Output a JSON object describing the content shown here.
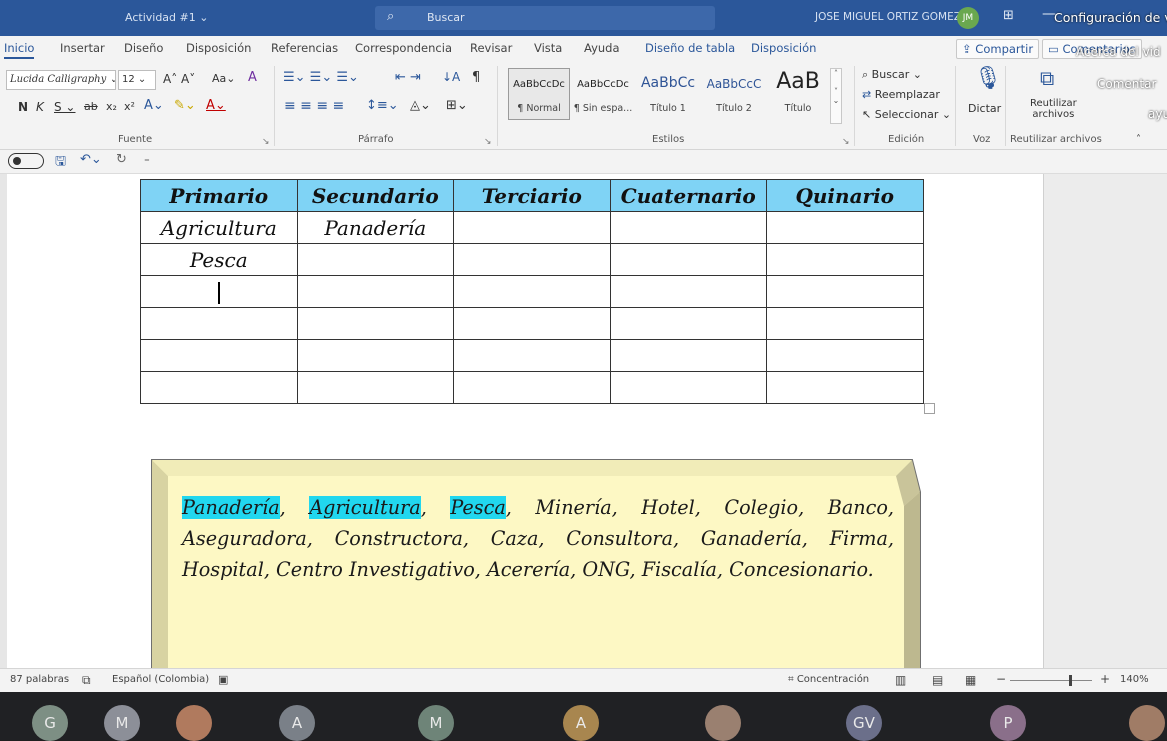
{
  "titlebar": {
    "doc_title": "Actividad #1",
    "dropdown_glyph": "⌄",
    "search_label": "Buscar",
    "user_name": "JOSE MIGUEL ORTIZ GOMEZ",
    "user_initials": "JM",
    "overlay_top": "Configuración de víd",
    "overlay_2": "Acerca del vid",
    "overlay_3": "Comentar",
    "overlay_4": "ayu"
  },
  "tabs": [
    "Inicio",
    "Insertar",
    "Diseño",
    "Disposición",
    "Referencias",
    "Correspondencia",
    "Revisar",
    "Vista",
    "Ayuda",
    "Diseño de tabla",
    "Disposición"
  ],
  "share_label": "Compartir",
  "comments_label": "Comentarios",
  "ribbon": {
    "font_name": "Lucida Calligraphy",
    "font_size": "12",
    "groups": {
      "font": "Fuente",
      "paragraph": "Párrafo",
      "styles": "Estilos",
      "editing": "Edición",
      "voice": "Voz",
      "reuse": "Reutilizar archivos"
    },
    "styles": [
      {
        "preview": "AaBbCcDc",
        "name": "¶ Normal"
      },
      {
        "preview": "AaBbCcDc",
        "name": "¶ Sin espa..."
      },
      {
        "preview": "AaBbCc",
        "name": "Título 1"
      },
      {
        "preview": "AaBbCcC",
        "name": "Título 2"
      },
      {
        "preview": "AaB",
        "name": "Título"
      }
    ],
    "editing": {
      "find": "Buscar",
      "replace": "Reemplazar",
      "select": "Seleccionar"
    },
    "dictate": "Dictar",
    "reuse_line1": "Reutilizar",
    "reuse_line2": "archivos"
  },
  "table": {
    "headers": [
      "Primario",
      "Secundario",
      "Terciario",
      "Cuaternario",
      "Quinario"
    ],
    "rows": [
      [
        "Agricultura",
        "Panadería",
        "",
        "",
        ""
      ],
      [
        "Pesca",
        "",
        "",
        "",
        ""
      ],
      [
        "",
        "",
        "",
        "",
        ""
      ],
      [
        "",
        "",
        "",
        "",
        ""
      ],
      [
        "",
        "",
        "",
        "",
        ""
      ],
      [
        "",
        "",
        "",
        "",
        ""
      ]
    ]
  },
  "note": {
    "highlighted": [
      "Panadería",
      "Agricultura",
      "Pesca"
    ],
    "rest": "Minería, Hotel, Colegio, Banco, Aseguradora, Constructora, Caza, Consultora, Ganadería, Firma, Hospital, Centro Investigativo, Acerería, ONG, Fiscalía, Concesionario.",
    "fill_color": "#fdf8c4"
  },
  "status": {
    "words": "87 palabras",
    "language": "Español (Colombia)",
    "focus": "Concentración",
    "zoom": "140%",
    "zoom_level": 0.72
  },
  "participants": [
    "G",
    "M",
    "",
    "A",
    "M",
    "A",
    "",
    "GV",
    "P",
    ""
  ],
  "colors": {
    "accent": "#2b579a",
    "header_fill": "#7fd3f5",
    "highlight": "#21d7ef"
  }
}
